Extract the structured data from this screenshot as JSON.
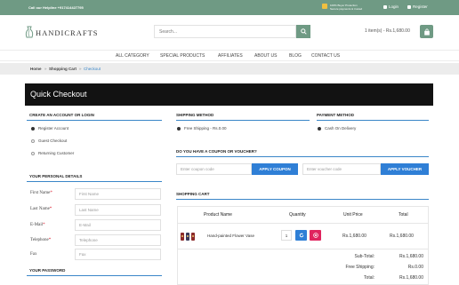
{
  "topbar": {
    "helpline": "Call our Helpline +917414427795",
    "protection_line1": "100% Buyer Protection",
    "protection_line2": "Secure payments & trusted",
    "login": "Login",
    "register": "Register"
  },
  "header": {
    "logo_text": "HANDICRAFTS",
    "search_placeholder": "Search...",
    "cart_summary": "1 item(s) - Rs.1,680.00"
  },
  "nav": {
    "items": [
      "ALL CATEGORY",
      "SPECIAL PRODUCTS",
      "AFFILIATES",
      "ABOUT US",
      "BLOG",
      "CONTACT US"
    ]
  },
  "breadcrumb": {
    "items": [
      "Home",
      "Shopping Cart",
      "Checkout"
    ]
  },
  "page": {
    "title": "Quick Checkout"
  },
  "account": {
    "heading": "CREATE AN ACCOUNT OR LOGIN",
    "options": [
      "Register Account",
      "Guest Checkout",
      "Returning Customer"
    ],
    "selected": 0
  },
  "personal": {
    "heading": "YOUR PERSONAL DETAILS",
    "fields": [
      {
        "label": "First Name",
        "required": "*",
        "placeholder": "First Name"
      },
      {
        "label": "Last Name",
        "required": "*",
        "placeholder": "Last Name"
      },
      {
        "label": "E-Mail",
        "required": "*",
        "placeholder": "E-Mail"
      },
      {
        "label": "Telephone",
        "required": "*",
        "placeholder": "Telephone"
      },
      {
        "label": "Fax",
        "required": "",
        "placeholder": "Fax"
      }
    ]
  },
  "password": {
    "heading": "YOUR PASSWORD"
  },
  "shipping": {
    "heading": "SHIPPING METHOD",
    "option": "Free Shipping - Rs.0.00"
  },
  "payment": {
    "heading": "PAYMENT METHOD",
    "option": "Cash On Delivery"
  },
  "coupon": {
    "heading": "DO YOU HAVE A COUPON OR VOUCHER?",
    "coupon_placeholder": "Enter coupon code",
    "coupon_button": "APPLY COUPON",
    "voucher_placeholder": "Enter voucher code",
    "voucher_button": "APPLY VOUCHER"
  },
  "cart": {
    "heading": "SHOPPING CART",
    "columns": [
      "Product Name",
      "Quantity",
      "Unit Price",
      "Total"
    ],
    "row": {
      "name": "Hand-painted Flower Vase",
      "quantity": "1",
      "unit_price": "Rs.1,680.00",
      "total": "Rs.1,680.00"
    },
    "totals": [
      {
        "label": "Sub-Total:",
        "value": "Rs.1,680.00"
      },
      {
        "label": "Free Shipping:",
        "value": "Rs.0.00"
      },
      {
        "label": "Total:",
        "value": "Rs.1,680.00"
      }
    ]
  },
  "colors": {
    "brand_green": "#6f9a84",
    "accent_blue": "#2f7fd6",
    "remove_red": "#e0245e"
  }
}
